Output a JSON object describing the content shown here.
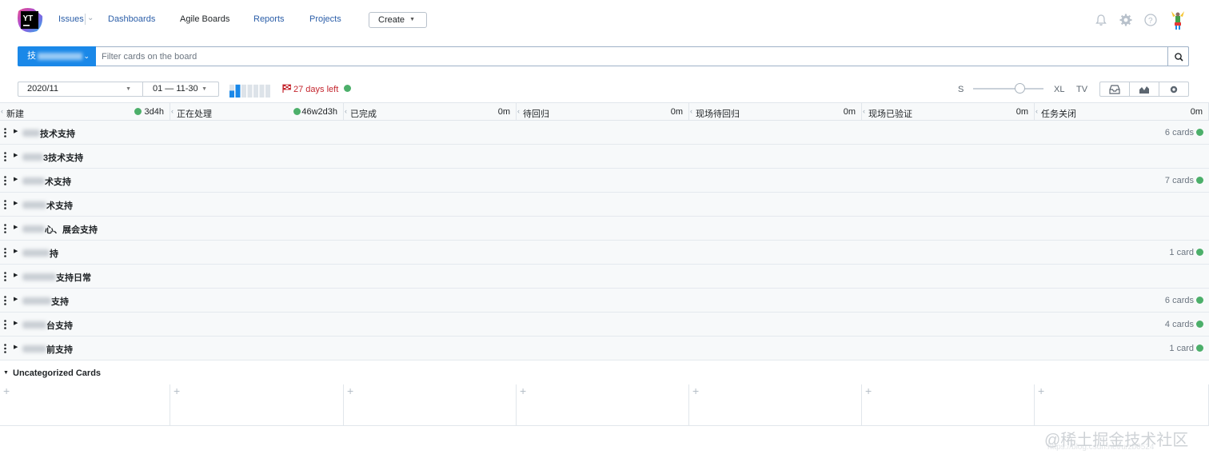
{
  "nav": {
    "logo_text": "YT",
    "issues": "Issues",
    "dashboards": "Dashboards",
    "agile_boards": "Agile Boards",
    "reports": "Reports",
    "projects": "Projects",
    "create": "Create",
    "icons": [
      "bell-icon",
      "gear-icon",
      "help-icon",
      "avatar"
    ]
  },
  "search": {
    "board_name_prefix": "技",
    "placeholder": "Filter cards on the board"
  },
  "sprint": {
    "name": "2020/11",
    "range": "01 — 11-30",
    "days_left": "27 days left",
    "progress_bars": [
      0.45,
      0.85,
      0.85,
      0.85,
      0.85,
      0.85,
      0.85
    ]
  },
  "view_controls": {
    "size_s": "S",
    "size_xl": "XL",
    "size_tv": "TV",
    "size_value": 0.6
  },
  "columns": [
    {
      "title": "新建",
      "time": "3d4h",
      "dot": true
    },
    {
      "title": "正在处理",
      "time": "46w2d3h",
      "dot": true
    },
    {
      "title": "已完成",
      "time": "0m",
      "dot": false
    },
    {
      "title": "待回归",
      "time": "0m",
      "dot": false
    },
    {
      "title": "现场待回归",
      "time": "0m",
      "dot": false
    },
    {
      "title": "现场已验证",
      "time": "0m",
      "dot": false
    },
    {
      "title": "任务关闭",
      "time": "0m",
      "dot": false
    }
  ],
  "swimlanes": [
    {
      "name": "技术支持",
      "count": "6 cards"
    },
    {
      "name": "3技术支持",
      "count": ""
    },
    {
      "name": "术支持",
      "count": "7 cards"
    },
    {
      "name": "术支持",
      "count": ""
    },
    {
      "name": "心、展会支持",
      "count": ""
    },
    {
      "name": "持",
      "count": "1 card"
    },
    {
      "name": "支持日常",
      "count": ""
    },
    {
      "name": "支持",
      "count": "6 cards"
    },
    {
      "name": "台支持",
      "count": "4 cards"
    },
    {
      "name": "前支持",
      "count": "1 card"
    }
  ],
  "uncategorized": {
    "title": "Uncategorized Cards",
    "plus": "+"
  },
  "watermark": {
    "text": "@稀土掘金技术社区",
    "url": "https://blog.csdn.net/u/zb0524"
  },
  "colors": {
    "accent_blue": "#1a88e8",
    "link_blue": "#2b5ea8",
    "green_dot": "#4caf6a",
    "warning_red": "#c4262e"
  }
}
